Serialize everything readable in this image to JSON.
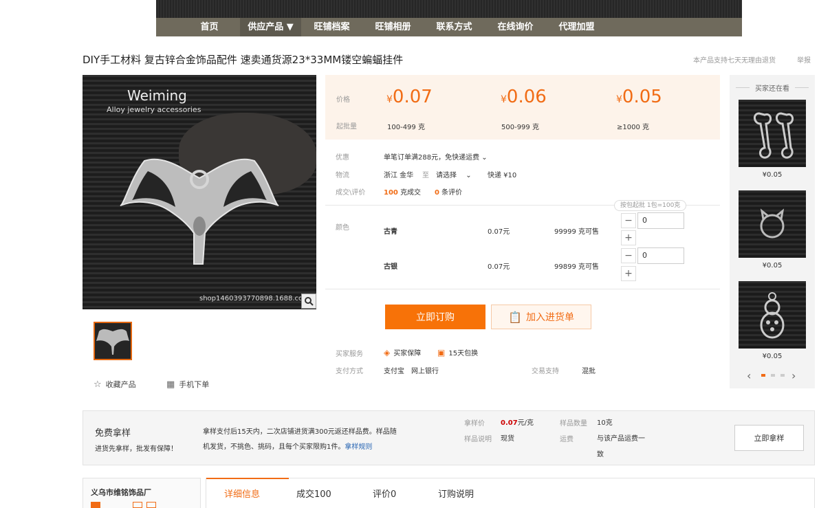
{
  "nav": {
    "items": [
      "首页",
      "供应产品 ▼",
      "旺铺档案",
      "旺铺相册",
      "联系方式",
      "在线询价",
      "代理加盟"
    ]
  },
  "product": {
    "title": "DIY手工材料 复古锌合金饰品配件 速卖通货源23*33MM镂空蝙蝠挂件",
    "return_notice": "本产品支持七天无理由退货",
    "report": "举报",
    "image_brand": "Weiming",
    "image_subtitle": "Alloy jewelry accessories",
    "image_watermark": "shop1460393770898.1688.com",
    "favorite": "收藏产品",
    "mobile_order": "手机下单"
  },
  "pricing": {
    "price_label": "价格",
    "moq_label": "起批量",
    "currency": "¥",
    "tiers": [
      {
        "price": "0.07",
        "range": "100-499 克"
      },
      {
        "price": "0.06",
        "range": "500-999 克"
      },
      {
        "price": "0.05",
        "range": "≥1000 克"
      }
    ]
  },
  "info": {
    "promo_label": "优惠",
    "promo_value": "单笔订单满288元，免快递运费",
    "logistics_label": "物流",
    "logistics_from": "浙江 金华",
    "logistics_to_word": "至",
    "logistics_select": "请选择",
    "logistics_express": "快递 ¥10",
    "deals_label": "成交\\评价",
    "deals_count": "100",
    "deals_unit": "克成交",
    "review_count": "0",
    "review_unit": "条评价"
  },
  "variants": {
    "label": "颜色",
    "pack_hint": "按包起批 1包=100克",
    "rows": [
      {
        "name": "古青",
        "price": "0.07元",
        "stock": "99999 克可售",
        "qty": "0"
      },
      {
        "name": "古银",
        "price": "0.07元",
        "stock": "99899 克可售",
        "qty": "0"
      }
    ]
  },
  "actions": {
    "order_now": "立即订购",
    "add_to_list": "加入进货单"
  },
  "services": {
    "label": "买家服务",
    "guarantee": "买家保障",
    "return_15": "15天包换",
    "payment_label": "支付方式",
    "payment_values": "支付宝　网上银行",
    "trade_label": "交易支持",
    "trade_value": "混批"
  },
  "side": {
    "title": "买家还在看",
    "prices": [
      "¥0.05",
      "¥0.05",
      "¥0.05"
    ]
  },
  "sample": {
    "title": "免费拿样",
    "subtitle": "进货先拿样，批发有保障！",
    "desc_1": "拿样支付后15天内，二次店铺进货满300元返还样品费。样品随",
    "desc_2": "机发货，不挑色、挑码，且每个买家限购1件。",
    "rules_link": "拿样规则",
    "sample_price_label": "拿样价",
    "sample_price": "0.07",
    "sample_price_unit": "元/克",
    "sample_note_label": "样品说明",
    "sample_note": "现货",
    "sample_qty_label": "样品数量",
    "sample_qty": "10克",
    "shipping_label": "运费",
    "shipping_value_1": "与该产品运费一",
    "shipping_value_2": "致",
    "button": "立即拿样"
  },
  "bottom": {
    "shop_name": "义乌市维铭饰品厂",
    "tabs": [
      "详细信息",
      "成交100",
      "评价0",
      "订购说明"
    ]
  },
  "colors": {
    "accent": "#f16c15",
    "nav_bg": "#6f6a5c"
  }
}
